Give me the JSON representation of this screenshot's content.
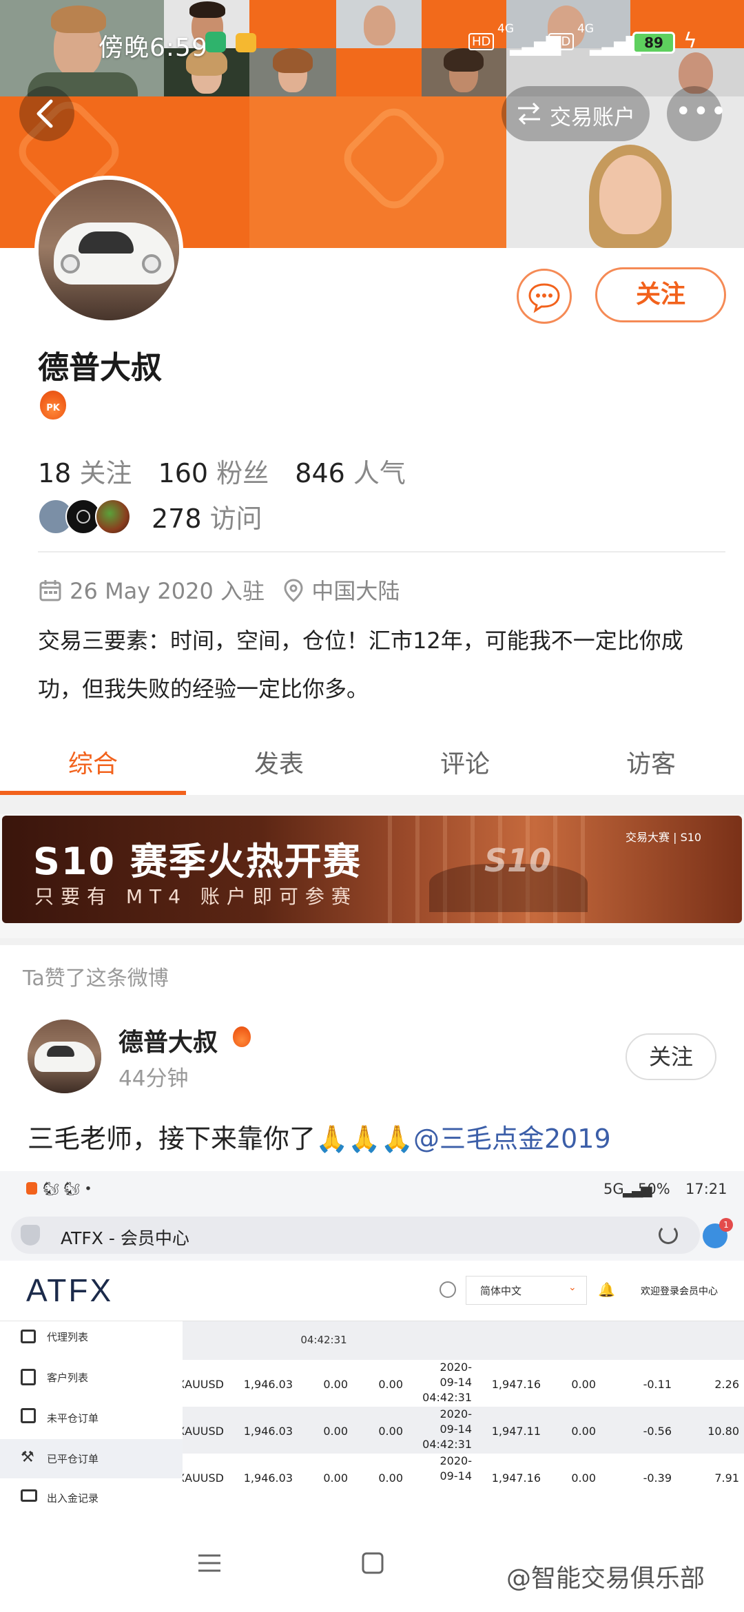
{
  "status_bar": {
    "time": "傍晚6:59",
    "battery": "89",
    "net1": "4G",
    "net2": "4G",
    "hd": "HD"
  },
  "header": {
    "trade_account_label": "交易账户"
  },
  "profile": {
    "name": "德普大叔",
    "follow_button": "关注",
    "badge": "PK",
    "stats": [
      {
        "value": "18",
        "label": "关注"
      },
      {
        "value": "160",
        "label": "粉丝"
      },
      {
        "value": "846",
        "label": "人气"
      }
    ],
    "visits": {
      "value": "278",
      "label": "访问"
    },
    "joined": "26 May 2020 入驻",
    "location": "中国大陆",
    "bio": "交易三要素：时间，空间，仓位！汇市12年，可能我不一定比你成功，但我失败的经验一定比你多。"
  },
  "tabs": [
    {
      "label": "综合",
      "active": true
    },
    {
      "label": "发表",
      "active": false
    },
    {
      "label": "评论",
      "active": false
    },
    {
      "label": "访客",
      "active": false
    }
  ],
  "banner": {
    "title": "S10 赛季火热开赛",
    "subtitle": "只要有 MT4 账户即可参赛",
    "brand": "交易大赛 | S10",
    "big_mark": "S10"
  },
  "feed": {
    "liked_label": "Ta赞了这条微博",
    "post": {
      "author": "德普大叔",
      "time": "44分钟",
      "follow_button": "关注",
      "text": "三毛老师，接下来靠你了🙏🙏🙏",
      "mention": "@三毛点金2019"
    }
  },
  "embedded_screenshot": {
    "status_time": "17:21",
    "status_battery": "50%",
    "status_network": "5G",
    "url_title": "ATFX - 会员中心",
    "notification_count": "1",
    "logo": "ATFX",
    "language": "简体中文",
    "login_link": "欢迎登录会员中心",
    "sidebar": [
      "代理列表",
      "客户列表",
      "未平仓订单",
      "已平仓订单",
      "出入金记录"
    ],
    "top_time": "04:42:31",
    "rows": [
      {
        "symbol": "XAUUSD",
        "open": "1,946.03",
        "sl": "0.00",
        "tp": "0.00",
        "date1": "2020-",
        "date2": "09-14",
        "date3": "04:42:31",
        "close": "1,947.16",
        "swap": "0.00",
        "commission": "-0.11",
        "profit": "2.26"
      },
      {
        "symbol": "XAUUSD",
        "open": "1,946.03",
        "sl": "0.00",
        "tp": "0.00",
        "date1": "2020-",
        "date2": "09-14",
        "date3": "04:42:31",
        "close": "1,947.11",
        "swap": "0.00",
        "commission": "-0.56",
        "profit": "10.80"
      },
      {
        "symbol": "XAUUSD",
        "open": "1,946.03",
        "sl": "0.00",
        "tp": "0.00",
        "date1": "2020-",
        "date2": "09-14",
        "date3": "",
        "close": "1,947.16",
        "swap": "0.00",
        "commission": "-0.39",
        "profit": "7.91"
      }
    ]
  },
  "bottom": {
    "watermark": "@智能交易俱乐部"
  },
  "colors": {
    "accent": "#f2621c",
    "cover_orange": "#f26a1b",
    "mention_blue": "#3b5ea8"
  }
}
